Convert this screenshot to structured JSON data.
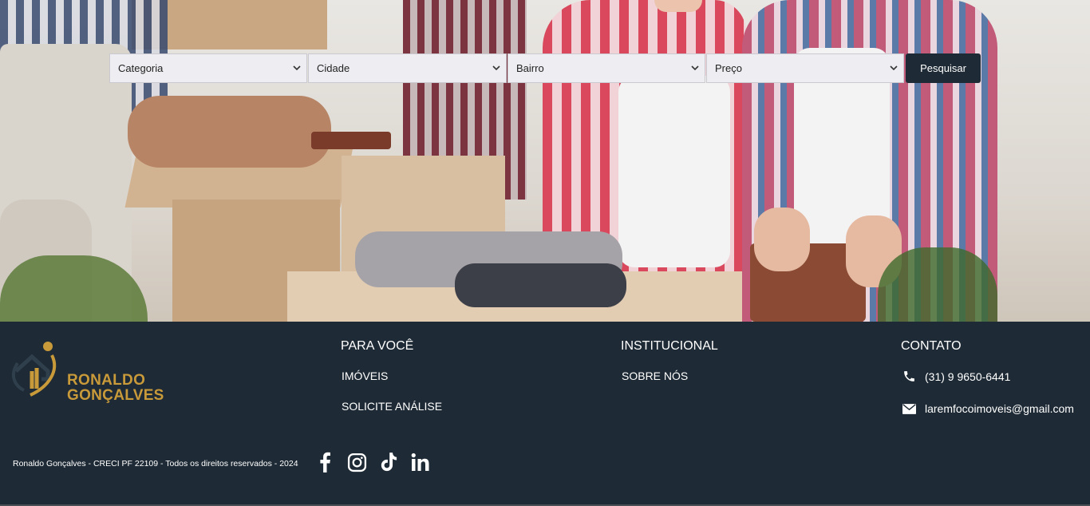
{
  "search": {
    "category": "Categoria",
    "city": "Cidade",
    "neighborhood": "Bairro",
    "price": "Preço",
    "button": "Pesquisar"
  },
  "footer": {
    "brand_line1": "RONALDO",
    "brand_line2": "GONÇALVES",
    "for_you": {
      "title": "PARA VOCÊ",
      "links": [
        "IMÓVEIS",
        "SOLICITE ANÁLISE"
      ]
    },
    "institutional": {
      "title": "INSTITUCIONAL",
      "links": [
        "SOBRE NÓS"
      ]
    },
    "contact": {
      "title": "CONTATO",
      "phone": "(31) 9 9650-6441",
      "email": "laremfocoimoveis@gmail.com"
    },
    "copyright": "Ronaldo Gonçalves - CRECI PF 22109 - Todos os direitos reservados - 2024",
    "social": [
      "facebook-icon",
      "instagram-icon",
      "tiktok-icon",
      "linkedin-icon"
    ]
  },
  "colors": {
    "footer_bg": "#1e2a35",
    "brand_gold": "#c99a3a"
  }
}
